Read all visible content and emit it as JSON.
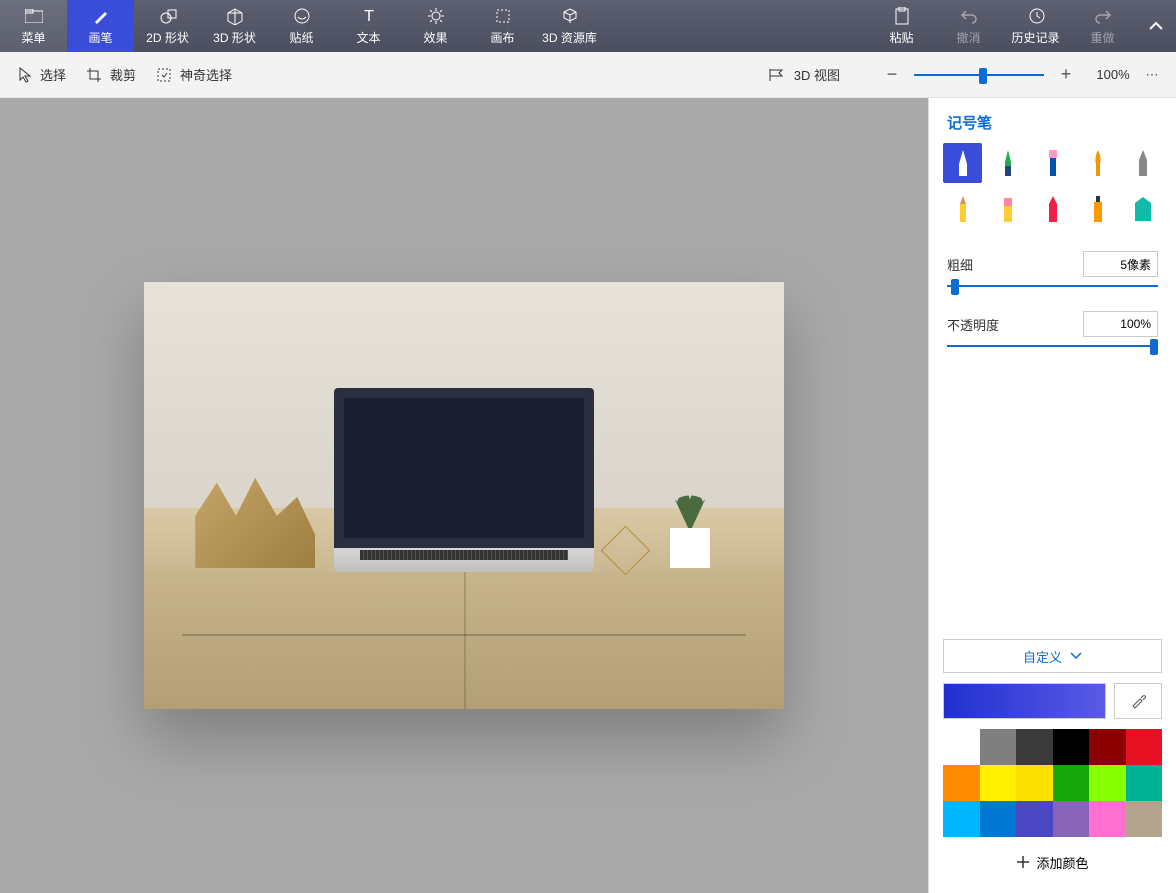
{
  "toolbar": {
    "menu": "菜单",
    "brush": "画笔",
    "shapes2d": "2D 形状",
    "shapes3d": "3D 形状",
    "stickers": "贴纸",
    "text": "文本",
    "effects": "效果",
    "canvas": "画布",
    "library3d": "3D 资源库",
    "paste": "粘贴",
    "undo": "撤消",
    "history": "历史记录",
    "redo": "重做"
  },
  "subtoolbar": {
    "select": "选择",
    "crop": "裁剪",
    "magic_select": "神奇选择",
    "view3d": "3D 视图",
    "zoom_pct": "100%"
  },
  "panel": {
    "title": "记号笔",
    "thickness_label": "粗细",
    "thickness_value": "5像素",
    "opacity_label": "不透明度",
    "opacity_value": "100%",
    "custom_label": "自定义",
    "add_color": "添加颜色"
  },
  "palette": [
    "#ffffff",
    "#7f7f7f",
    "#3a3a3a",
    "#000000",
    "#8b0000",
    "#e81123",
    "#ff8c00",
    "#fff100",
    "#fce100",
    "#16a60c",
    "#88ff00",
    "#00b294",
    "#00b7ff",
    "#0078d4",
    "#4b47c3",
    "#8764b8",
    "#ff6fcf",
    "#b3a38c"
  ]
}
